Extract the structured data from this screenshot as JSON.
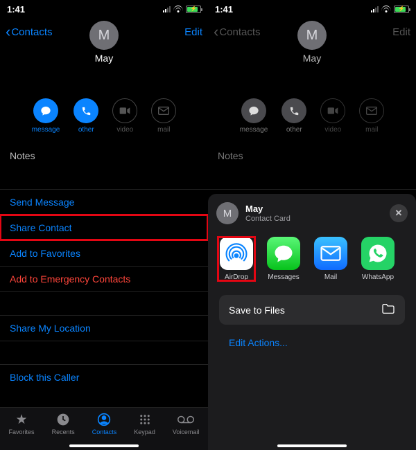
{
  "status": {
    "time": "1:41"
  },
  "nav": {
    "back": "Contacts",
    "edit": "Edit"
  },
  "contact": {
    "initial": "M",
    "name": "May"
  },
  "actions": {
    "message": "message",
    "other": "other",
    "video": "video",
    "mail": "mail"
  },
  "rows": {
    "notes": "Notes",
    "send_message": "Send Message",
    "share_contact": "Share Contact",
    "add_favorites": "Add to Favorites",
    "add_emergency": "Add to Emergency Contacts",
    "share_location": "Share My Location",
    "block": "Block this Caller"
  },
  "tabs": {
    "favorites": "Favorites",
    "recents": "Recents",
    "contacts": "Contacts",
    "keypad": "Keypad",
    "voicemail": "Voicemail"
  },
  "sheet": {
    "initial": "M",
    "title": "May",
    "subtitle": "Contact Card",
    "apps": {
      "airdrop": "AirDrop",
      "messages": "Messages",
      "mail": "Mail",
      "whatsapp": "WhatsApp"
    },
    "save_files": "Save to Files",
    "edit_actions": "Edit Actions..."
  }
}
